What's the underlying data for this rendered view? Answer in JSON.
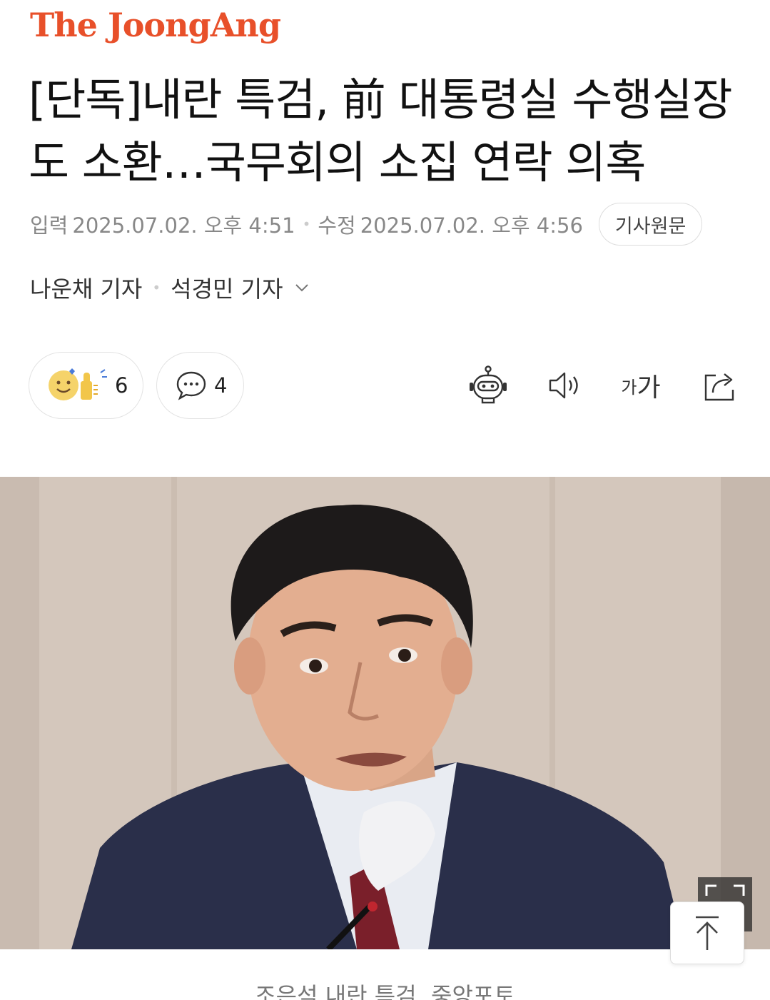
{
  "brand": {
    "logo_text": "The JoongAng",
    "color": "#e8502a"
  },
  "article": {
    "headline": "[단독]내란 특검, 前 대통령실 수행실장도 소환…국무회의 소집 연락 의혹",
    "input_label": "입력",
    "input_time": "2025.07.02. 오후 4:51",
    "update_label": "수정",
    "update_time": "2025.07.02. 오후 4:56",
    "original_button": "기사원문",
    "reporters": [
      "나운채 기자",
      "석경민 기자"
    ]
  },
  "actions": {
    "reaction_count": "6",
    "comment_count": "4",
    "font_size_label_small": "가",
    "font_size_label_large": "가"
  },
  "icons": {
    "reaction": "smiley-thumbs-up-icon",
    "comment": "speech-bubble-icon",
    "summary_bot": "robot-icon",
    "read_aloud": "speaker-icon",
    "font_size": "font-size-icon",
    "share": "share-icon",
    "scroll_top": "arrow-up-icon",
    "expand": "expand-icon",
    "byline_more": "chevron-down-icon"
  },
  "photo": {
    "caption": "조은석 내란 특검. 중앙포토"
  }
}
